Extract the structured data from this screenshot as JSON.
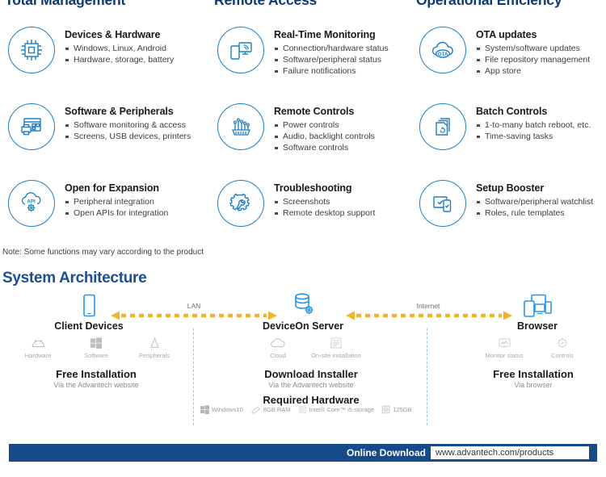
{
  "columns": [
    {
      "heading": "Total Management"
    },
    {
      "heading": "Remote Access"
    },
    {
      "heading": "Operational Efficiency"
    }
  ],
  "features": [
    {
      "icon": "chip-icon",
      "title": "Devices & Hardware",
      "bullets": [
        "Windows, Linux, Android",
        "Hardware, storage, battery"
      ]
    },
    {
      "icon": "monitor-phone-signal-icon",
      "title": "Real-Time Monitoring",
      "bullets": [
        "Connection/hardware status",
        "Software/peripheral status",
        "Failure notifications"
      ]
    },
    {
      "icon": "cloud-ota-icon",
      "title": "OTA updates",
      "bullets": [
        "System/software updates",
        "File repository management",
        "App store"
      ]
    },
    {
      "icon": "window-printer-icon",
      "title": "Software & Peripherals",
      "bullets": [
        "Software monitoring & access",
        "Screens, USB devices, printers"
      ]
    },
    {
      "icon": "circuit-board-icon",
      "title": "Remote Controls",
      "bullets": [
        "Power controls",
        "Audio, backlight controls",
        "Software controls"
      ]
    },
    {
      "icon": "stacked-pages-icon",
      "title": "Batch Controls",
      "bullets": [
        "1-to-many batch reboot, etc.",
        "Time-saving tasks"
      ]
    },
    {
      "icon": "cloud-api-gear-icon",
      "title": "Open for Expansion",
      "bullets": [
        "Peripheral integration",
        "Open APIs for integration"
      ]
    },
    {
      "icon": "gear-wrench-icon",
      "title": "Troubleshooting",
      "bullets": [
        "Screenshots",
        "Remote desktop support"
      ]
    },
    {
      "icon": "screen-phone-check-icon",
      "title": "Setup Booster",
      "bullets": [
        "Software/peripheral watchlist",
        "Roles, rule templates"
      ]
    }
  ],
  "note": "Note: Some functions may vary according to the product",
  "architecture": {
    "title": "System Architecture",
    "nodes": [
      {
        "id": "client",
        "icon": "tablet-icon",
        "name": "Client Devices",
        "sub_items": [
          {
            "icon": "android-icon",
            "label": "Hardware"
          },
          {
            "icon": "windows-icon",
            "label": "Software"
          },
          {
            "icon": "peripherals-icon",
            "label": "Peripherals"
          }
        ],
        "block_heading": "Free Installation",
        "block_sub": "Via the Advantech website"
      },
      {
        "id": "server",
        "icon": "database-gear-icon",
        "name": "DeviceOn Server",
        "sub_items": [
          {
            "icon": "cloud-icon",
            "label": "Cloud"
          },
          {
            "icon": "onsite-list-icon",
            "label": "On-site installation"
          }
        ],
        "block_heading": "Download Installer",
        "block_sub": "Via the Advantech website",
        "hardware_heading": "Required Hardware",
        "hardware": [
          {
            "icon": "windows-icon",
            "label": "Windows10"
          },
          {
            "icon": "ram-icon",
            "label": "8GB RAM"
          },
          {
            "icon": "cpu-icon",
            "label": "Intel® Core™ i5 storage"
          },
          {
            "icon": "storage-icon",
            "label": "125GB"
          }
        ]
      },
      {
        "id": "browser",
        "icon": "multi-screen-icon",
        "name": "Browser",
        "sub_items": [
          {
            "icon": "monitor-status-icon",
            "label": "Monitor status"
          },
          {
            "icon": "controls-gear-icon",
            "label": "Controls"
          }
        ],
        "block_heading": "Free Installation",
        "block_sub": "Via browser"
      }
    ],
    "links": [
      {
        "id": "lan",
        "label": "LAN"
      },
      {
        "id": "internet",
        "label": "Internet"
      }
    ]
  },
  "footer": {
    "label": "Online Download",
    "url": "www.advantech.com/products"
  },
  "colors": {
    "brand_blue": "#1b7fc4",
    "heading_navy": "#0d3a75",
    "arch_title_blue": "#1b4e96",
    "footer_bar": "#164a8a",
    "arrow_yellow": "#f5b32a",
    "divider_blue": "#9fc4e5"
  }
}
